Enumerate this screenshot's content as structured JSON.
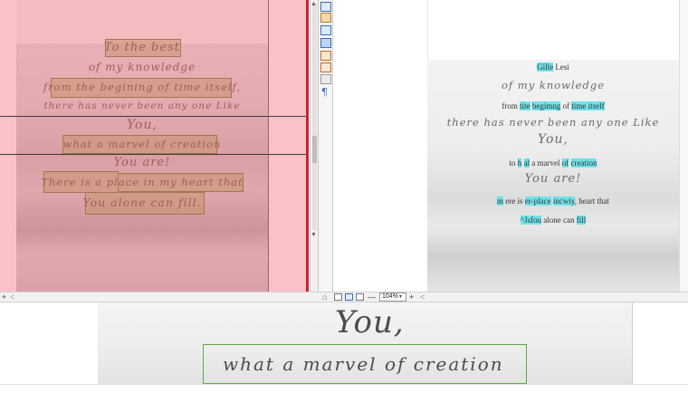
{
  "left_poem": {
    "l1": "To the best",
    "l2": "of my knowledge",
    "l3": "from the begining of time itself,",
    "l4": "there has never been any one Like",
    "l5": "You,",
    "l6": "what a marvel of creation",
    "l7": "You are!",
    "l8": "There is a place in my heart that",
    "l9": "You alone can fill."
  },
  "right_text": {
    "r1_hl": "Gille",
    "r1_rest": " Lesi",
    "r2": "of my knowledge",
    "r3_a": "from ",
    "r3_b": "tite",
    "r3_c": " ",
    "r3_d": "begimng",
    "r3_e": " of ",
    "r3_f": "time itself",
    "r4": "there has never been any one Like",
    "r5": "You,",
    "r6_a": "to ",
    "r6_b": "h",
    "r6_c": " ",
    "r6_d": "al",
    "r6_e": " a marvel ",
    "r6_f": "of",
    "r6_g": " ",
    "r6_h": "creation",
    "r7": "You are!",
    "r8_a": "m",
    "r8_b": " ere is ",
    "r8_c": "er-place",
    "r8_d": " ",
    "r8_e": "incwiy",
    "r8_f": ", heart that",
    "r9_a": "^Jsfou",
    "r9_b": " alone can ",
    "r9_c": "fill"
  },
  "statusbar": {
    "plus_left": "+",
    "left_arrow": "<",
    "zoom_value": "104%",
    "minus": "—",
    "plus": "+",
    "right_arrow": "<"
  },
  "zoom_strip": {
    "line1": "You,",
    "line2": "what a marvel of creation"
  },
  "colors": {
    "overlay": "#ff7882",
    "box_fill": "#a0aa5f",
    "ocr_highlight": "#6fe3ea",
    "splitter_red": "#c2272d"
  },
  "icons": [
    "split-view-icon",
    "page-icon",
    "text-view-icon",
    "image-view-icon",
    "zoom-icon",
    "settings-icon",
    "pilcrow-icon"
  ]
}
